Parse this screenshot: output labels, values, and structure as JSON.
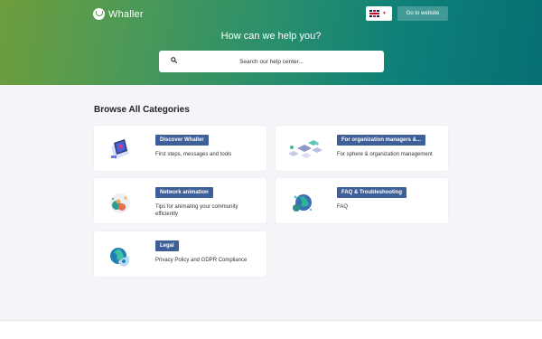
{
  "brand": {
    "name": "Whaller"
  },
  "header": {
    "language_flag": "uk-flag-icon",
    "goto_label": "Go to website"
  },
  "hero": {
    "title": "How can we help you?"
  },
  "search": {
    "placeholder": "Search our help center..."
  },
  "browse": {
    "title": "Browse All Categories"
  },
  "categories": [
    {
      "label": "Discover Whaller",
      "description": "First steps, messages and tools",
      "icon": "laptop-illustration-icon"
    },
    {
      "label": "For organization managers &...",
      "description": "For sphere & organization management",
      "icon": "network-servers-illustration-icon"
    },
    {
      "label": "Network animation",
      "description": "Tips for animating your community efficiently",
      "icon": "community-illustration-icon"
    },
    {
      "label": "FAQ & Troubleshooting",
      "description": "FAQ",
      "icon": "globe-illustration-icon"
    },
    {
      "label": "Legal",
      "description": "Privacy Policy and GDPR Compliance",
      "icon": "shield-globe-illustration-icon"
    }
  ],
  "colors": {
    "badge": "#3f5f99",
    "hero_start": "#6e9d3c",
    "hero_end": "#076f74",
    "background": "#f3f5f9"
  }
}
